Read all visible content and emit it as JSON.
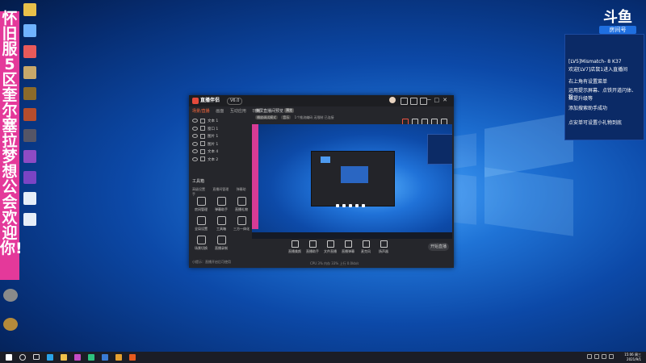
{
  "desktop": {
    "icons": [
      {
        "label": "Desktop icon",
        "color": "#e8c04a"
      },
      {
        "label": "Desktop icon",
        "color": "#6fb3ff"
      },
      {
        "label": "Desktop icon",
        "color": "#e85a5a"
      },
      {
        "label": "Desktop icon",
        "color": "#c8a86a"
      },
      {
        "label": "Desktop icon",
        "color": "#8b6a2a"
      },
      {
        "label": "Desktop icon",
        "color": "#b64d2d"
      },
      {
        "label": "Desktop icon",
        "color": "#555566"
      },
      {
        "label": "Desktop icon",
        "color": "#8e4bc4"
      },
      {
        "label": "Desktop icon",
        "color": "#7b44c4"
      },
      {
        "label": "Desktop icon",
        "color": "#e6eef8"
      },
      {
        "label": "Desktop icon",
        "color": "#e6eef8"
      }
    ],
    "bottom_icons": [
      {
        "label": "",
        "color": "#8a8a8a"
      },
      {
        "label": "",
        "color": "#b58a3a"
      }
    ]
  },
  "banner": {
    "text": "怀旧服5区奎尔塞拉梦想公会欢迎你!"
  },
  "douyu": {
    "logo": "斗鱼",
    "room_label": "房间号",
    "room_id": "7465276"
  },
  "dock": {
    "messages": [
      "[LV5]Mismatch- 8 K37",
      "欢迎[LV7]店鼠1进入直播间",
      "右上角有设置菜单",
      "运用提示屏幕、点铁开道闪体、粉",
      "丝提升级等",
      "添加搜索助手成功",
      "点安单可设置小礼物到底"
    ]
  },
  "app": {
    "title": "直播伴侣",
    "version": "V6.0",
    "tabs": [
      "场景/直播",
      "画面",
      "互动应用",
      "玩播"
    ],
    "sources": [
      "文本 1",
      "窗口 1",
      "图片 1",
      "图片 1",
      "文本 4",
      "文本 2"
    ],
    "tools_heading": "工具箱",
    "tools_sub": [
      "高级设置",
      "直播间管理",
      "弹幕助手"
    ],
    "tools": [
      {
        "label": "房间管理"
      },
      {
        "label": "弹幕助手"
      },
      {
        "label": "直播礼物"
      },
      {
        "label": "全局设置"
      },
      {
        "label": "工具箱"
      },
      {
        "label": "三方一体化"
      },
      {
        "label": "场景切换"
      },
      {
        "label": "直播录制"
      }
    ],
    "status_text": "小提示：直播开启后可使用",
    "preview_title": "横屏直播间预览",
    "preview_badge": "预览",
    "preview_info": [
      "播放调试模式",
      "音乐",
      "1个推流编码",
      "无限制",
      "已连接"
    ],
    "bottom_buttons": [
      {
        "label": "直播美颜"
      },
      {
        "label": "直播助手"
      },
      {
        "label": "文件直播"
      },
      {
        "label": "直播弹幕"
      },
      {
        "label": "麦克风"
      },
      {
        "label": "扬声器"
      }
    ],
    "go_live": "开始直播",
    "bottom_status": "CPU 3% 内存 33% 上行 0.0kb/s"
  },
  "taskbar": {
    "items": [
      {
        "name": "start",
        "color": "#ffffff"
      },
      {
        "name": "search",
        "color": "#dddddd"
      },
      {
        "name": "task-view",
        "color": "#dddddd"
      },
      {
        "name": "edge",
        "color": "#2aa3e8"
      },
      {
        "name": "explorer",
        "color": "#f0c04a"
      },
      {
        "name": "app-1",
        "color": "#c44bc4"
      },
      {
        "name": "app-2",
        "color": "#2ec27e"
      },
      {
        "name": "app-3",
        "color": "#3a7bd5"
      },
      {
        "name": "app-4",
        "color": "#e6a030"
      },
      {
        "name": "app-5",
        "color": "#e55a1f"
      }
    ],
    "time": "15:06 周三",
    "date": "2021/9/1"
  }
}
